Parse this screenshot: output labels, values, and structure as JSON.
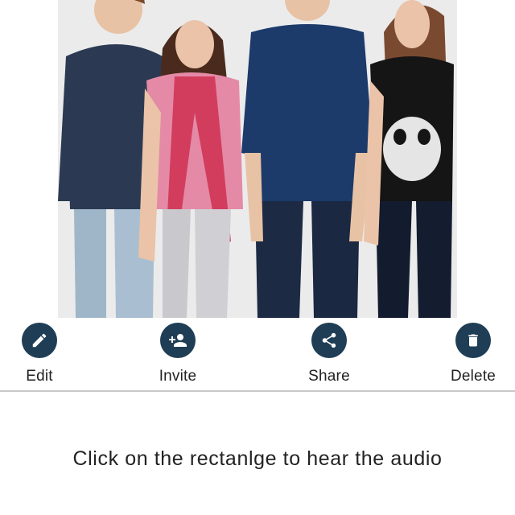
{
  "photo": {
    "description_icon": "group-photo-image"
  },
  "actions": [
    {
      "id": "edit",
      "label": "Edit",
      "icon": "pencil-icon"
    },
    {
      "id": "invite",
      "label": "Invite",
      "icon": "add-person-icon"
    },
    {
      "id": "share",
      "label": "Share",
      "icon": "share-icon"
    },
    {
      "id": "delete",
      "label": "Delete",
      "icon": "trash-icon"
    }
  ],
  "instruction": {
    "text": "Click on the rectanlge to hear the audio"
  },
  "colors": {
    "icon_circle": "#1f3e55",
    "divider": "#c9c9c9",
    "text": "#222222",
    "background": "#ffffff"
  }
}
